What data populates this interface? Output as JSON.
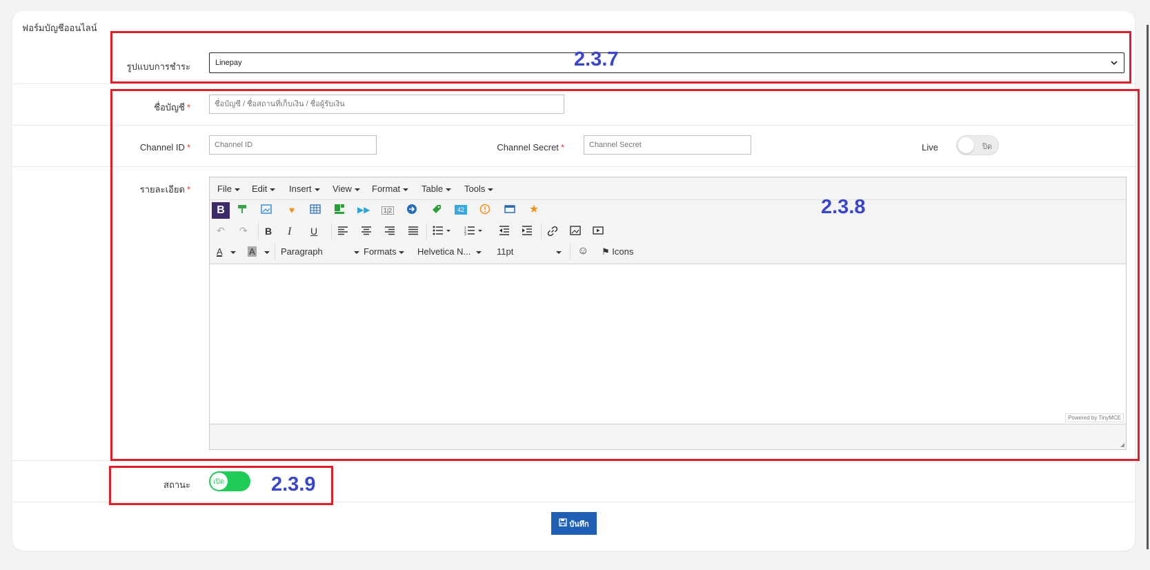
{
  "form": {
    "title": "ฟอร์มบัญชีออนไลน์",
    "payment_type": {
      "label": "รูปแบบการชำระ",
      "value": "Linepay"
    },
    "account_name": {
      "label": "ชื่อบัญชี",
      "required": "*",
      "placeholder": "ชื่อบัญชี / ชื่อสถานที่เก็บเงิน / ชื่อผู้รับเงิน"
    },
    "channel_id": {
      "label": "Channel ID",
      "required": "*",
      "placeholder": "Channel ID"
    },
    "channel_secret": {
      "label": "Channel Secret",
      "required": "*",
      "placeholder": "Channel Secret"
    },
    "live": {
      "label": "Live",
      "toggle_text": "ปิด",
      "on": false
    },
    "details": {
      "label": "รายละเอียด",
      "required": "*"
    },
    "status": {
      "label": "สถานะ",
      "toggle_text": "เปิด",
      "on": true
    },
    "save_label": "บันทึก"
  },
  "editor": {
    "menus": [
      "File",
      "Edit",
      "Insert",
      "View",
      "Format",
      "Table",
      "Tools"
    ],
    "block_format": "Paragraph",
    "formats_label": "Formats",
    "font_family": "Helvetica N...",
    "font_size": "11pt",
    "icons_label": "Icons",
    "powered_by": "Powered by TinyMCE",
    "plugin_icons": [
      "bold-box-icon",
      "paint-roller-icon",
      "image-icon",
      "heart-icon",
      "table-icon",
      "layout-icon",
      "arrows-icon",
      "page-numbers-icon",
      "arrow-circle-icon",
      "tag-icon",
      "number-badge-icon",
      "alert-circle-icon",
      "window-icon",
      "star-icon"
    ]
  },
  "annotations": {
    "a237": "2.3.7",
    "a238": "2.3.8",
    "a239": "2.3.9"
  },
  "colors": {
    "annotation_box": "#e01e2a",
    "annotation_text": "#3a45c9",
    "toggle_on": "#1fcc56",
    "save_button": "#1e5fb4"
  }
}
